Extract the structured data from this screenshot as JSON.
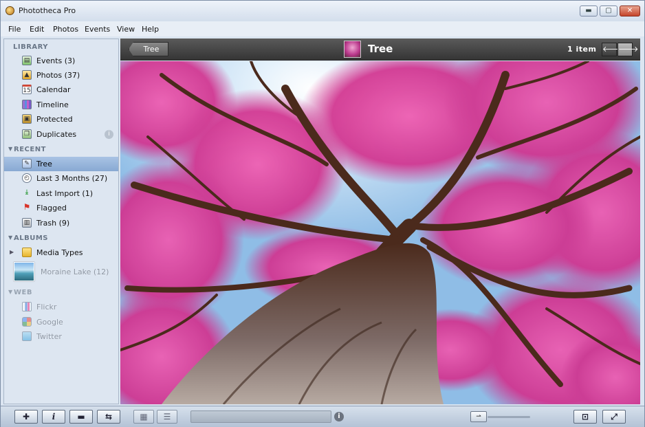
{
  "window": {
    "title": "Phototheca Pro",
    "minimize": "▬",
    "maximize": "▢",
    "close": "✕"
  },
  "menu": [
    "File",
    "Edit",
    "Photos",
    "Events",
    "View",
    "Help"
  ],
  "sidebar": {
    "library": {
      "heading": "LIBRARY",
      "items": [
        {
          "label": "Events (3)",
          "icon": "events-icon"
        },
        {
          "label": "Photos (37)",
          "icon": "photos-icon"
        },
        {
          "label": "Calendar",
          "icon": "calendar-icon"
        },
        {
          "label": "Timeline",
          "icon": "timeline-icon"
        },
        {
          "label": "Protected",
          "icon": "lock-icon"
        },
        {
          "label": "Duplicates",
          "icon": "duplicates-icon",
          "badge": "i"
        }
      ]
    },
    "recent": {
      "heading": "RECENT",
      "items": [
        {
          "label": "Tree",
          "icon": "edit-icon",
          "selected": true
        },
        {
          "label": "Last 3 Months (27)",
          "icon": "clock-icon"
        },
        {
          "label": "Last Import (1)",
          "icon": "import-icon"
        },
        {
          "label": "Flagged",
          "icon": "flag-icon"
        },
        {
          "label": "Trash (9)",
          "icon": "trash-icon"
        }
      ]
    },
    "albums": {
      "heading": "ALBUMS",
      "items": [
        {
          "label": "Media Types",
          "icon": "folder-icon"
        },
        {
          "label": "Moraine Lake (12)",
          "icon": "album-thumbnail"
        }
      ]
    },
    "web": {
      "heading": "WEB",
      "items": [
        {
          "label": "Flickr",
          "icon": "flickr-icon"
        },
        {
          "label": "Google",
          "icon": "google-icon"
        },
        {
          "label": "Twitter",
          "icon": "twitter-icon"
        }
      ]
    }
  },
  "viewer": {
    "back_label": "Tree",
    "title": "Tree",
    "item_count": "1 item",
    "prev": "🡐",
    "next": "🡒"
  },
  "colors": {
    "accent_selected": "#9bb7dc",
    "header_dark": "#404040",
    "blossom": "#d2338f",
    "sky": "#8fbde6",
    "bark": "#4b2a1c"
  }
}
